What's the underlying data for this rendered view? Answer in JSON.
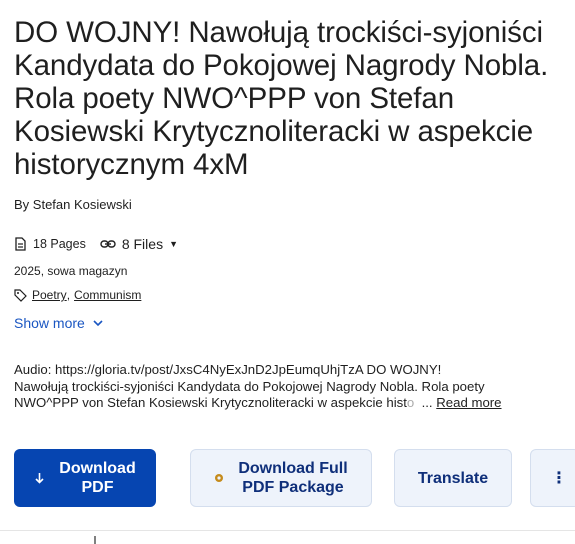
{
  "title_lines": [
    "DO WOJNY! Nawołują trockiści-syjoniści",
    "Kandydata do Pokojowej Nagrody Nobla.",
    "Rola poety NWO^PPP von Stefan",
    "Kosiewski Krytycznoliteracki w aspekcie",
    "historycznym 4xM"
  ],
  "byline": "By Stefan Kosiewski",
  "meta": {
    "pages": "18 Pages",
    "files": "8 Files",
    "year_publisher": "2025, sowa magazyn",
    "tags": [
      "Poetry",
      "Communism"
    ],
    "tag_separator": ","
  },
  "show_more_label": "Show more",
  "abstract": {
    "line1": "Audio: https://gloria.tv/post/JxsC4NyExJnD2JpEumqUhjTzA DO WOJNY!",
    "line2": "Nawołują trockiści-syjoniści Kandydata do Pokojowej Nagrody Nobla. Rola poety",
    "line3_visible": "NWO^PPP von Stefan Kosiewski Krytycznoliteracki w aspekcie hist",
    "line3_faded": "o",
    "ellipsis": "...",
    "read_more": "Read more"
  },
  "buttons": {
    "download_line1": "Download",
    "download_line2": "PDF",
    "full_line1": "Download Full",
    "full_line2": "PDF Package",
    "translate": "Translate",
    "more": "⋮"
  },
  "colors": {
    "primary": "#0645b1",
    "secondary_bg": "#eef3fb",
    "link": "#1a56c2",
    "package_dot": "#c58b1c"
  }
}
